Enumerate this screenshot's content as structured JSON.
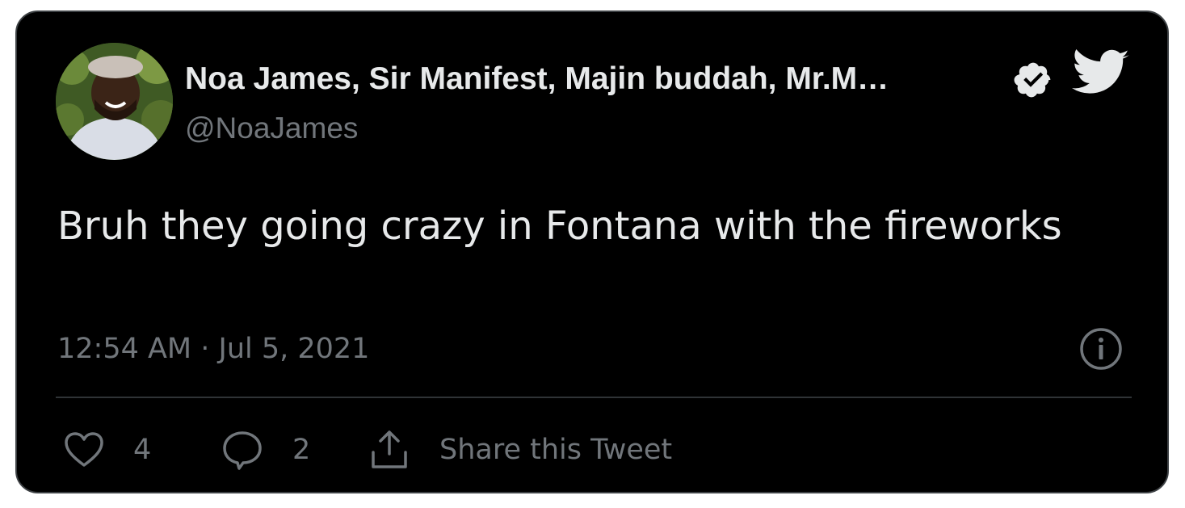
{
  "tweet": {
    "author": {
      "display_name": "Noa James, Sir Manifest, Majin buddah, Mr.M…",
      "handle": "@NoaJames",
      "verified": true,
      "avatar_icon": "profile-photo"
    },
    "text": "Bruh they going crazy in Fontana with the fireworks",
    "timestamp": "12:54 AM · Jul 5, 2021",
    "brand_icon": "twitter-bird",
    "info_icon": "info-circle"
  },
  "actions": {
    "likes": {
      "icon": "heart-outline",
      "count": "4"
    },
    "replies": {
      "icon": "speech-bubble",
      "count": "2"
    },
    "share": {
      "icon": "share-upload",
      "label": "Share this Tweet"
    }
  },
  "colors": {
    "background": "#000000",
    "primary_text": "#e7e9ea",
    "secondary_text": "#71767b",
    "border": "#3d4144",
    "divider": "#2f3336"
  }
}
